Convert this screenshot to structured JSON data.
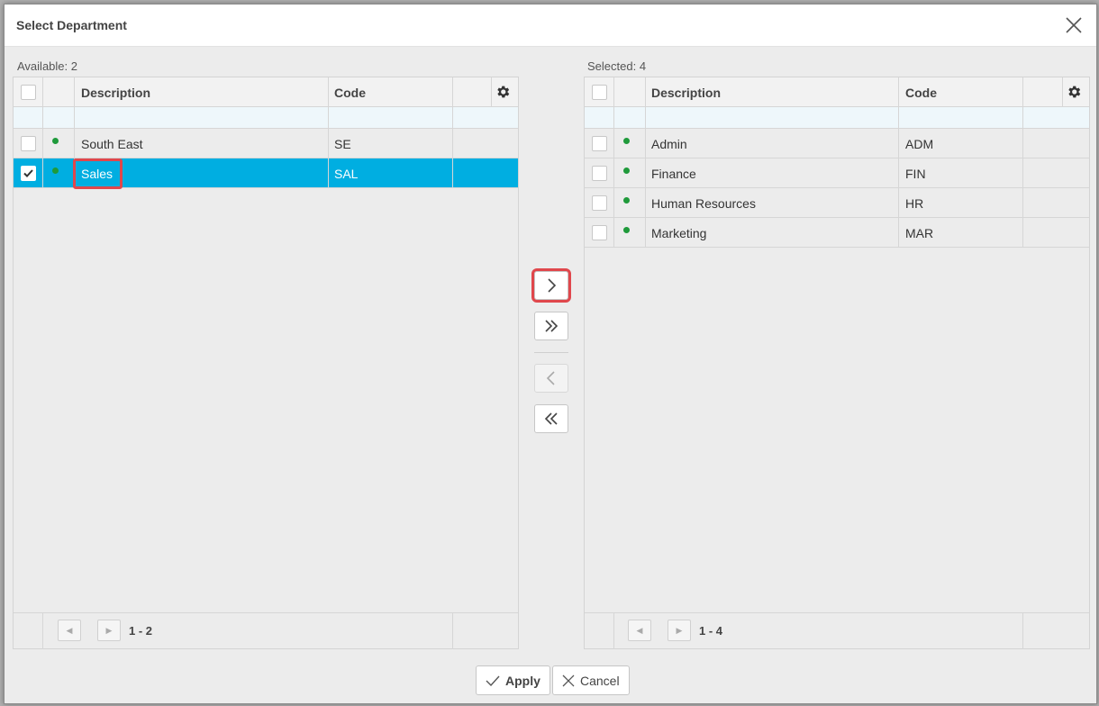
{
  "dialog": {
    "title": "Select Department",
    "close_icon": "close-icon"
  },
  "available": {
    "count_label": "Available: 2",
    "columns": {
      "description": "Description",
      "code": "Code"
    },
    "rows": [
      {
        "description": "South East",
        "code": "SE",
        "checked": false,
        "status": "active"
      },
      {
        "description": "Sales",
        "code": "SAL",
        "checked": true,
        "status": "active"
      }
    ],
    "pager_text": "1 - 2"
  },
  "selected": {
    "count_label": "Selected: 4",
    "columns": {
      "description": "Description",
      "code": "Code"
    },
    "rows": [
      {
        "description": "Admin",
        "code": "ADM",
        "checked": false,
        "status": "active"
      },
      {
        "description": "Finance",
        "code": "FIN",
        "checked": false,
        "status": "active"
      },
      {
        "description": "Human Resources",
        "code": "HR",
        "checked": false,
        "status": "active"
      },
      {
        "description": "Marketing",
        "code": "MAR",
        "checked": false,
        "status": "active"
      }
    ],
    "pager_text": "1 - 4"
  },
  "move_buttons": [
    {
      "name": "move-right-button",
      "icon": "chevron-right-icon",
      "enabled": true
    },
    {
      "name": "move-all-right-button",
      "icon": "double-chevron-right-icon",
      "enabled": true
    },
    {
      "name": "move-left-button",
      "icon": "chevron-left-icon",
      "enabled": false
    },
    {
      "name": "move-all-left-button",
      "icon": "double-chevron-left-icon",
      "enabled": true
    }
  ],
  "footer": {
    "apply_label": "Apply",
    "cancel_label": "Cancel"
  },
  "colors": {
    "selected_row": "#00aee1",
    "status_dot": "#1f9a3b",
    "highlight": "#e0474c"
  }
}
